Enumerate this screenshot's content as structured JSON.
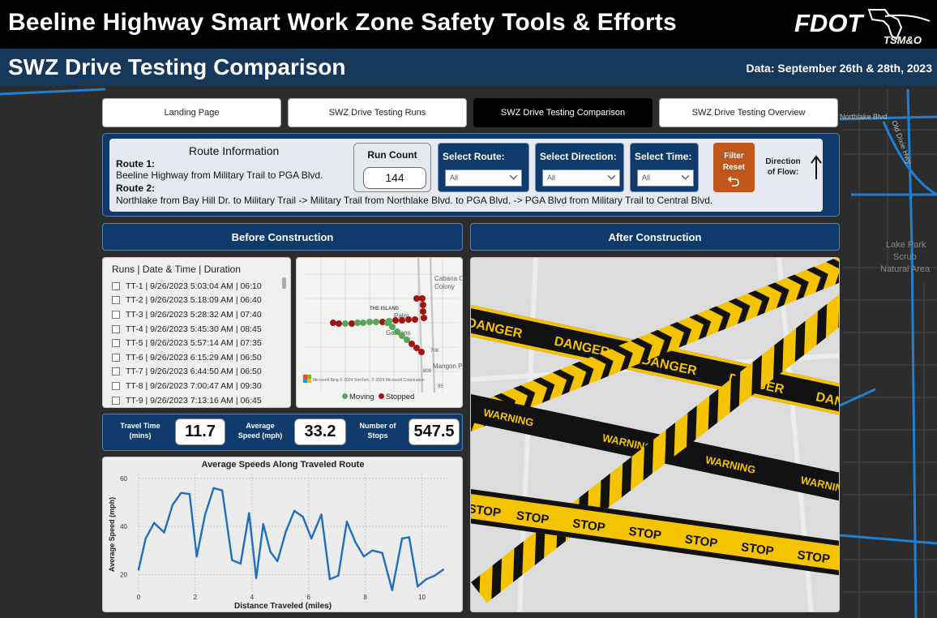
{
  "header": {
    "title": "Beeline Highway Smart Work Zone Safety Tools & Efforts",
    "logo_text": "FDOT",
    "logo_sub": "TSM&O",
    "subtitle": "SWZ Drive Testing Comparison",
    "data_date": "Data: September 26th & 28th, 2023"
  },
  "background_map": {
    "labels": [
      "Northlake Blvd",
      "Old Dixie Hwy",
      "Lake Park Scrub Natural Area"
    ]
  },
  "nav": {
    "tabs": [
      {
        "label": "Landing Page",
        "active": false
      },
      {
        "label": "SWZ Drive Testing Runs",
        "active": false
      },
      {
        "label": "SWZ Drive Testing Comparison",
        "active": true
      },
      {
        "label": "SWZ Drive Testing Overview",
        "active": false
      }
    ]
  },
  "route_info": {
    "title": "Route Information",
    "route1_label": "Route 1:",
    "route1_text": "Beeline Highway from Military Trail to PGA Blvd.",
    "route2_label": "Route 2:",
    "route2_text": "Northlake from Bay Hill Dr. to Military Trail -> Military Trail from Northlake Blvd. to PGA Blvd. -> PGA Blvd from Military Trail to Central Blvd.",
    "run_count_label": "Run Count",
    "run_count_value": "144",
    "select_route_label": "Select Route:",
    "select_route_value": "All",
    "select_direction_label": "Select Direction:",
    "select_direction_value": "All",
    "select_time_label": "Select Time:",
    "select_time_value": "All",
    "filter_reset_label": "Filter Reset",
    "direction_label": "Direction of Flow:",
    "direction_icon": "arrow-up-icon"
  },
  "before": {
    "header": "Before Construction",
    "runs_header": "Runs | Date & Time | Duration",
    "runs": [
      "TT-1 | 9/26/2023 5:03:04 AM | 06:10",
      "TT-2 | 9/26/2023 5:18:09 AM | 06:40",
      "TT-3 | 9/26/2023 5:28:32 AM | 07:40",
      "TT-4 | 9/26/2023 5:45:30 AM | 08:45",
      "TT-5 | 9/26/2023 5:57:14 AM | 07:35",
      "TT-6 | 9/26/2023 6:15:29 AM | 06:50",
      "TT-7 | 9/26/2023 6:44:50 AM | 06:50",
      "TT-8 | 9/26/2023 7:00:47 AM | 09:30",
      "TT-9 | 9/26/2023 7:13:16 AM | 06:45"
    ],
    "map": {
      "labels": [
        "Cabana Colony",
        "THE ISLAND",
        "Palm",
        "Gardens",
        "Mangon Park",
        "708",
        "809",
        "95"
      ],
      "attribution": "Microsoft Bing  © 2024 TomTom, © 2024 Microsoft Corporation",
      "legend": [
        {
          "label": "Moving",
          "color": "#5aa55a"
        },
        {
          "label": "Stopped",
          "color": "#a01414"
        }
      ]
    },
    "kpis": {
      "travel_time_label": "Travel Time (mins)",
      "travel_time_value": "11.7",
      "avg_speed_label": "Average Speed (mph)",
      "avg_speed_value": "33.2",
      "stops_label": "Number of Stops",
      "stops_value": "547.5"
    }
  },
  "after": {
    "header": "After Construction",
    "tape_words": {
      "danger": "DANGER",
      "warning": "WARNING",
      "stop": "STOP"
    }
  },
  "chart_data": {
    "type": "line",
    "title": "Average Speeds Along Traveled Route",
    "xlabel": "Distance Traveled (miles)",
    "ylabel": "Average Speed (mph)",
    "xlim": [
      0,
      10.9
    ],
    "ylim": [
      12,
      62
    ],
    "xticks": [
      0,
      2,
      4,
      6,
      8,
      10
    ],
    "yticks": [
      20,
      40,
      60
    ],
    "grid": true,
    "color": "#1f6fc0",
    "x": [
      0,
      0.25,
      0.55,
      0.9,
      1.2,
      1.5,
      1.8,
      2.05,
      2.35,
      2.65,
      2.95,
      3.3,
      3.6,
      3.9,
      4.15,
      4.4,
      4.65,
      4.9,
      5.2,
      5.5,
      5.8,
      6.1,
      6.45,
      6.75,
      7.05,
      7.35,
      7.65,
      7.95,
      8.25,
      8.6,
      8.95,
      9.3,
      9.55,
      9.85,
      10.15,
      10.45,
      10.75
    ],
    "y": [
      22,
      35,
      41.5,
      37.5,
      49,
      54,
      53.5,
      27.5,
      45,
      56,
      55,
      26,
      24.5,
      45.5,
      18.5,
      41,
      29.5,
      25.5,
      38,
      46.5,
      44,
      35,
      45,
      18,
      19.5,
      42,
      33.5,
      27.5,
      30,
      29,
      13.5,
      35,
      35.5,
      15,
      18,
      19.5,
      22
    ]
  }
}
